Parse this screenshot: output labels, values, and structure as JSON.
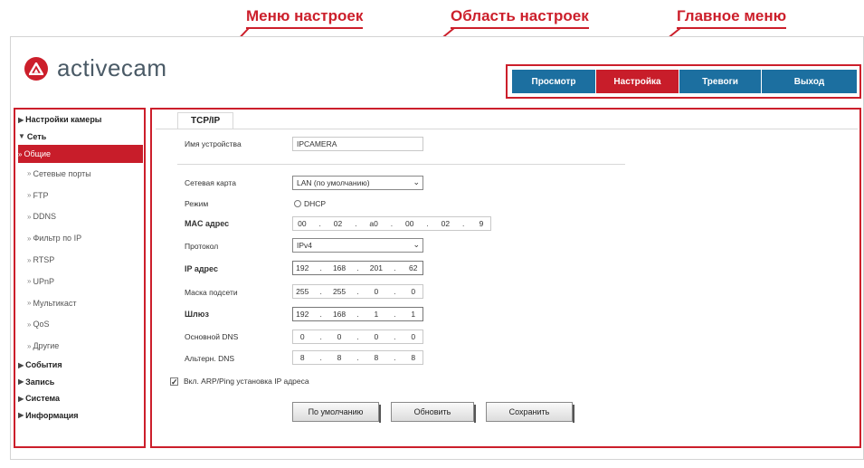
{
  "callouts": {
    "settings_menu": "Меню настроек",
    "settings_area": "Область настроек",
    "main_menu": "Главное меню"
  },
  "logo": {
    "text": "activecam"
  },
  "main_menu": [
    {
      "label": "Просмотр",
      "active": false
    },
    {
      "label": "Настройка",
      "active": true
    },
    {
      "label": "Тревоги",
      "active": false
    },
    {
      "label": "Выход",
      "active": false
    }
  ],
  "sidebar": {
    "items": [
      {
        "label": "Настройки камеры",
        "arrow": "▶",
        "type": "top"
      },
      {
        "label": "Сеть",
        "arrow": "▼",
        "type": "top"
      },
      {
        "label": "Общие",
        "arrow": "»",
        "type": "selected"
      },
      {
        "label": "Сетевые порты",
        "arrow": "»",
        "type": "sub"
      },
      {
        "label": "FTP",
        "arrow": "»",
        "type": "sub"
      },
      {
        "label": "DDNS",
        "arrow": "»",
        "type": "sub"
      },
      {
        "label": "Фильтр по IP",
        "arrow": "»",
        "type": "sub"
      },
      {
        "label": "RTSP",
        "arrow": "»",
        "type": "sub"
      },
      {
        "label": "UPnP",
        "arrow": "»",
        "type": "sub"
      },
      {
        "label": "Мультикаст",
        "arrow": "»",
        "type": "sub"
      },
      {
        "label": "QoS",
        "arrow": "»",
        "type": "sub"
      },
      {
        "label": "Другие",
        "arrow": "»",
        "type": "sub"
      },
      {
        "label": "События",
        "arrow": "▶",
        "type": "top"
      },
      {
        "label": "Запись",
        "arrow": "▶",
        "type": "top"
      },
      {
        "label": "Система",
        "arrow": "▶",
        "type": "top"
      },
      {
        "label": "Информация",
        "arrow": "▶",
        "type": "top"
      }
    ]
  },
  "settings": {
    "tab": "TCP/IP",
    "device_name_label": "Имя устройства",
    "device_name_value": "IPCAMERA",
    "network_card_label": "Сетевая карта",
    "network_card_value": "LAN (по умолчанию)",
    "mode_label": "Режим",
    "mode_value": "DHCP",
    "mac_label": "MAC адрес",
    "mac_value": [
      "00",
      "02",
      "a0",
      "00",
      "02",
      "9"
    ],
    "protocol_label": "Протокол",
    "protocol_value": "IPv4",
    "ip_label": "IP адрес",
    "ip_value": [
      "192",
      "168",
      "201",
      "62"
    ],
    "mask_label": "Маска подсети",
    "mask_value": [
      "255",
      "255",
      "0",
      "0"
    ],
    "gateway_label": "Шлюз",
    "gateway_value": [
      "192",
      "168",
      "1",
      "1"
    ],
    "dns1_label": "Основной DNS",
    "dns1_value": [
      "0",
      "0",
      "0",
      "0"
    ],
    "dns2_label": "Альтерн. DNS",
    "dns2_value": [
      "8",
      "8",
      "8",
      "8"
    ],
    "checkbox_label": "Вкл. ARP/Ping установка IP адреса",
    "checkbox_checked": true,
    "buttons": [
      "По умолчанию",
      "Обновить",
      "Сохранить"
    ]
  },
  "colors": {
    "accent_red": "#c81d2a",
    "menu_blue": "#1c6fa0"
  }
}
